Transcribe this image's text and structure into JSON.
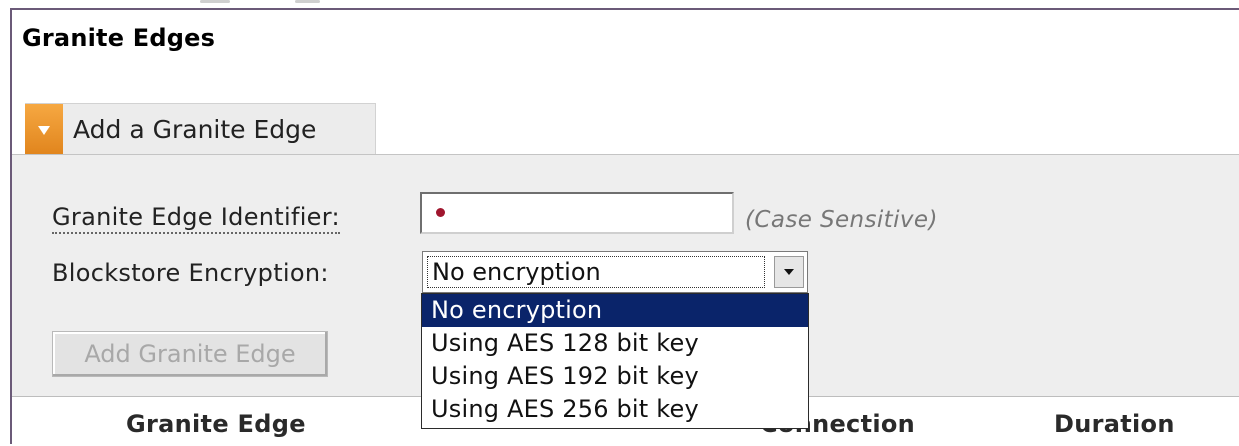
{
  "section": {
    "title": "Granite Edges"
  },
  "add_panel": {
    "toggle_label": "Add a Granite Edge",
    "identifier_label": "Granite Edge Identifier:",
    "identifier_value": "",
    "case_note": "(Case Sensitive)",
    "encryption_label": "Blockstore Encryption:",
    "encryption_selected": "No encryption",
    "encryption_options": [
      "No encryption",
      "Using AES 128 bit key",
      "Using AES 192 bit key",
      "Using AES 256 bit key"
    ],
    "submit_label": "Add Granite Edge"
  },
  "table": {
    "columns": [
      "Granite Edge",
      "Connection",
      "Duration"
    ]
  },
  "colors": {
    "toggle_icon": "#f0a03a",
    "selected_option": "#0a246a",
    "required_marker": "#a0162e"
  },
  "icons": {
    "toggle": "triangle-down-icon",
    "select_arrow": "chevron-down-icon"
  }
}
